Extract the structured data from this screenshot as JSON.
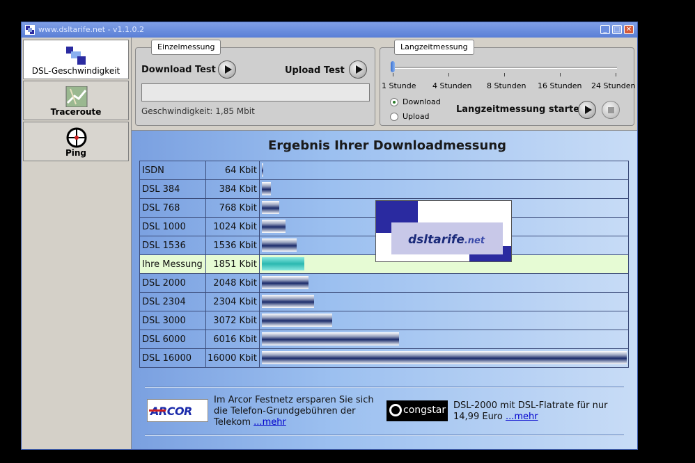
{
  "window": {
    "title": "www.dsltarife.net - v1.1.0.2"
  },
  "sidebar": {
    "items": [
      {
        "label": "DSL-Geschwindigkeit",
        "active": true,
        "icon": "dsl-squares-icon"
      },
      {
        "label": "Traceroute",
        "active": false,
        "icon": "map-icon"
      },
      {
        "label": "Ping",
        "active": false,
        "icon": "crosshair-icon"
      }
    ]
  },
  "einzelmessung": {
    "tab": "Einzelmessung",
    "download_label": "Download Test",
    "upload_label": "Upload Test",
    "speed_text": "Geschwindigkeit: 1,85 Mbit"
  },
  "langzeit": {
    "tab": "Langzeitmessung",
    "ticks": [
      "1 Stunde",
      "4 Stunden",
      "8 Stunden",
      "16 Stunden",
      "24 Stunden"
    ],
    "slider_value": "1 Stunde",
    "radio_download": "Download",
    "radio_upload": "Upload",
    "selected": "Download",
    "start_label": "Langzeitmessung starten"
  },
  "result": {
    "title": "Ergebnis Ihrer Downloadmessung",
    "max_kbit": 16000,
    "rows": [
      {
        "name": "ISDN",
        "value": "64 Kbit",
        "kbit": 64
      },
      {
        "name": "DSL 384",
        "value": "384 Kbit",
        "kbit": 384
      },
      {
        "name": "DSL 768",
        "value": "768 Kbit",
        "kbit": 768
      },
      {
        "name": "DSL 1000",
        "value": "1024 Kbit",
        "kbit": 1024
      },
      {
        "name": "DSL 1536",
        "value": "1536 Kbit",
        "kbit": 1536
      },
      {
        "name": "Ihre Messung",
        "value": "1851 Kbit",
        "kbit": 1851,
        "highlight": true
      },
      {
        "name": "DSL 2000",
        "value": "2048 Kbit",
        "kbit": 2048
      },
      {
        "name": "DSL 2304",
        "value": "2304 Kbit",
        "kbit": 2304
      },
      {
        "name": "DSL 3000",
        "value": "3072 Kbit",
        "kbit": 3072
      },
      {
        "name": "DSL 6000",
        "value": "6016 Kbit",
        "kbit": 6016
      },
      {
        "name": "DSL 16000",
        "value": "16000 Kbit",
        "kbit": 16000
      }
    ]
  },
  "logo": {
    "main": "dsltarife",
    "tld": ".net"
  },
  "ads": {
    "arcor": {
      "brand": "ARCOR",
      "line1": "Im Arcor Festnetz ersparen Sie sich",
      "line2": "die Telefon-Grundgebühren der",
      "line3": "Telekom",
      "link": "...mehr"
    },
    "congstar": {
      "brand": "congstar",
      "line1": "DSL-2000 mit DSL-Flatrate für nur",
      "line2": "14,99 Euro",
      "link": "...mehr"
    }
  },
  "colors": {
    "highlight_row": "#e6fbd4",
    "bar_highlight": "#2ab8b0",
    "link": "#0000cc"
  }
}
